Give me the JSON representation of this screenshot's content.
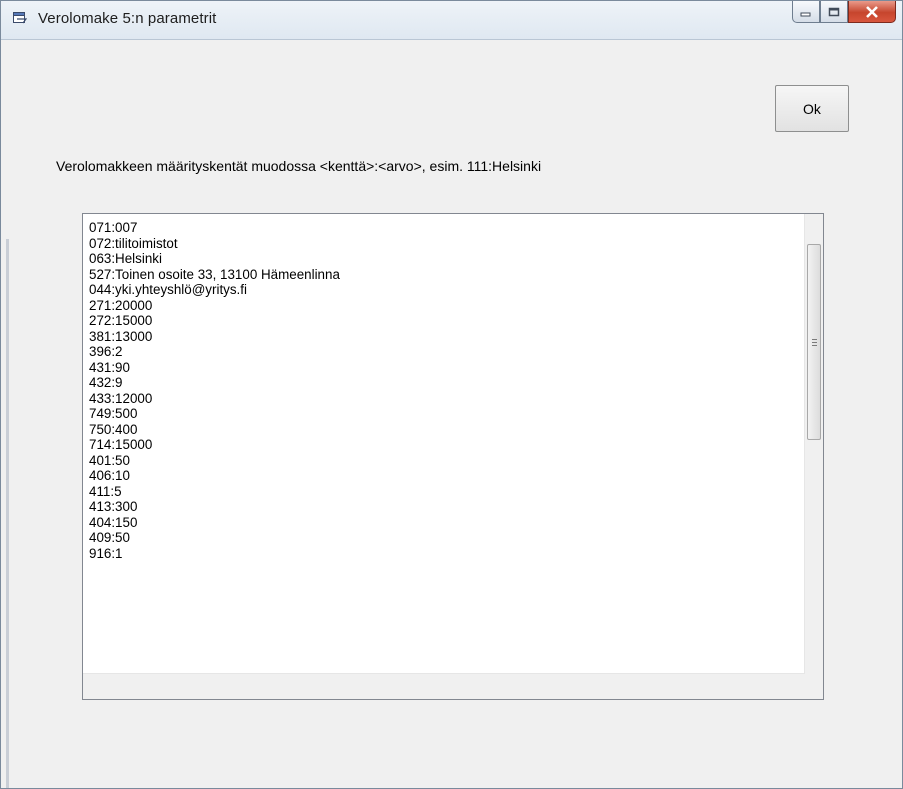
{
  "window": {
    "title": "Verolomake 5:n parametrit",
    "icons": {
      "app": "app-window-icon",
      "minimize": "minimize-icon",
      "maximize": "maximize-icon",
      "close": "close-icon"
    }
  },
  "ok_button": {
    "label": "Ok"
  },
  "description": "Verolomakkeen määrityskentät muodossa <kenttä>:<arvo>, esim. 111:Helsinki",
  "fields": {
    "lines": [
      "071:007",
      "072:tilitoimistot",
      "063:Helsinki",
      "527:Toinen osoite 33, 13100 Hämeenlinna",
      "044:yki.yhteyshlö@yritys.fi",
      "271:20000",
      "272:15000",
      "381:13000",
      "396:2",
      "431:90",
      "432:9",
      "433:12000",
      "749:500",
      "750:400",
      "714:15000",
      "401:50",
      "406:10",
      "411:5",
      "413:300",
      "404:150",
      "409:50",
      "916:1"
    ]
  },
  "colors": {
    "close_button": "#c6452d",
    "window_bg": "#f0f0f0",
    "text_bg": "#ffffff"
  }
}
